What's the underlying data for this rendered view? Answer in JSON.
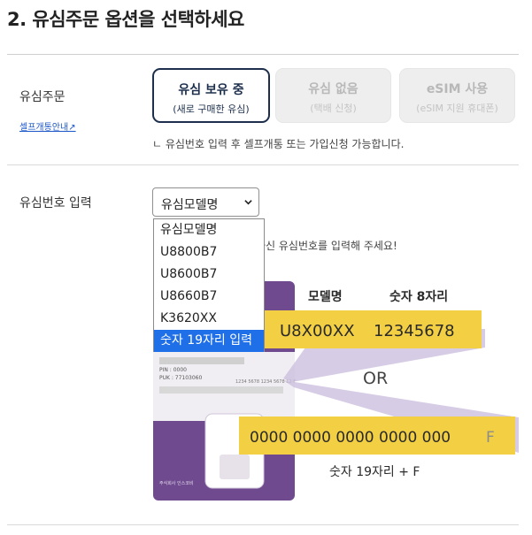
{
  "page_title": "2. 유심주문 옵션을 선택하세요",
  "usim_order": {
    "label": "유심주문",
    "self_link": "셀프개통안내↗",
    "options": [
      {
        "title": "유심 보유 중",
        "sub": "(새로 구매한 유심)"
      },
      {
        "title": "유심 없음",
        "sub": "(택배 신청)"
      },
      {
        "title": "eSIM 사용",
        "sub": "(eSIM 지원 휴대폰)"
      }
    ],
    "note": "ㄴ 유심번호 입력 후 셀프개통 또는 가입신청 가능합니다."
  },
  "usim_number": {
    "label": "유심번호 입력",
    "select_value": "유심모델명",
    "options": [
      "유심모델명",
      "U8800B7",
      "U8600B7",
      "U8660B7",
      "K3620XX",
      "숫자 19자리 입력"
    ],
    "selected_index": 5,
    "note": "하신 유심번호를 입력해 주세요!"
  },
  "illustration": {
    "model_header": "모델명",
    "digits8_header": "숫자 8자리",
    "model_code": "U8X00XX",
    "model_digits": "12345678",
    "or_text": "OR",
    "long_number": "0000 0000 0000 0000 000",
    "suffix": "F",
    "caption": "숫자 19자리 + F",
    "card_pin": "PIN : 0000",
    "card_puk": "PUK : 77103060",
    "card_strip_number": "1234 5678 1234 5678 12 F",
    "card_company": "주식회사 인스코비"
  },
  "colors": {
    "active_border": "#1d2f4d",
    "highlight_yellow": "#f2cf43",
    "card_purple": "#6f4a8e",
    "dropdown_selected": "#1e6fe8"
  }
}
